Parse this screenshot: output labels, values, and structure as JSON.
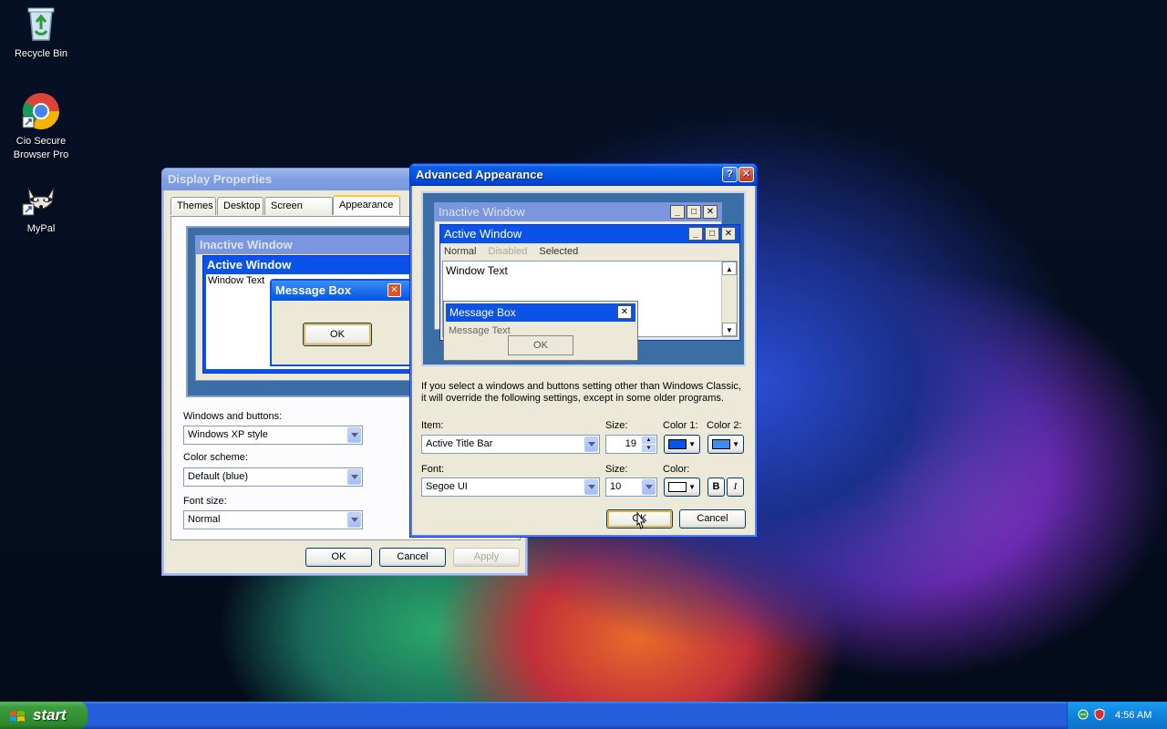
{
  "desktop": {
    "icons": [
      {
        "label": "Recycle Bin",
        "icon": "recycle-bin-icon"
      },
      {
        "label": "Cio Secure Browser Pro",
        "icon": "chrome-icon"
      },
      {
        "label": "MyPal",
        "icon": "raccoon-icon"
      }
    ]
  },
  "display_properties": {
    "title": "Display Properties",
    "tabs": [
      "Themes",
      "Desktop",
      "Screen Saver",
      "Appearance"
    ],
    "active_tab": "Appearance",
    "preview": {
      "inactive_title": "Inactive Window",
      "active_title": "Active Window",
      "window_text": "Window Text",
      "message_box_title": "Message Box",
      "ok_label": "OK"
    },
    "windows_buttons_label": "Windows and buttons:",
    "windows_buttons_value": "Windows XP style",
    "color_scheme_label": "Color scheme:",
    "color_scheme_value": "Default (blue)",
    "font_size_label": "Font size:",
    "font_size_value": "Normal",
    "ok_label": "OK",
    "cancel_label": "Cancel",
    "apply_label": "Apply"
  },
  "advanced_appearance": {
    "title": "Advanced Appearance",
    "help_glyph": "?",
    "close_glyph": "✕",
    "preview": {
      "inactive_title": "Inactive Window",
      "active_title": "Active Window",
      "menu_normal": "Normal",
      "menu_disabled": "Disabled",
      "menu_selected": "Selected",
      "window_text": "Window Text",
      "message_box_title": "Message Box",
      "message_text": "Message Text",
      "ok_label": "OK"
    },
    "info_line1": "If you select a windows and buttons setting other than Windows Classic,",
    "info_line2": "it will override the following settings, except in some older programs.",
    "item_label": "Item:",
    "item_value": "Active Title Bar",
    "size_label": "Size:",
    "item_size_value": "19",
    "color1_label": "Color 1:",
    "color2_label": "Color 2:",
    "color1": "#0b53e8",
    "color2": "#3c8cf0",
    "font_label": "Font:",
    "font_value": "Segoe UI",
    "font_size_label": "Size:",
    "font_size_value": "10",
    "font_color_label": "Color:",
    "font_color": "#ffffff",
    "bold_label": "B",
    "italic_label": "I",
    "ok_label": "OK",
    "cancel_label": "Cancel"
  },
  "taskbar": {
    "start_label": "start",
    "clock": "4:56 AM"
  }
}
